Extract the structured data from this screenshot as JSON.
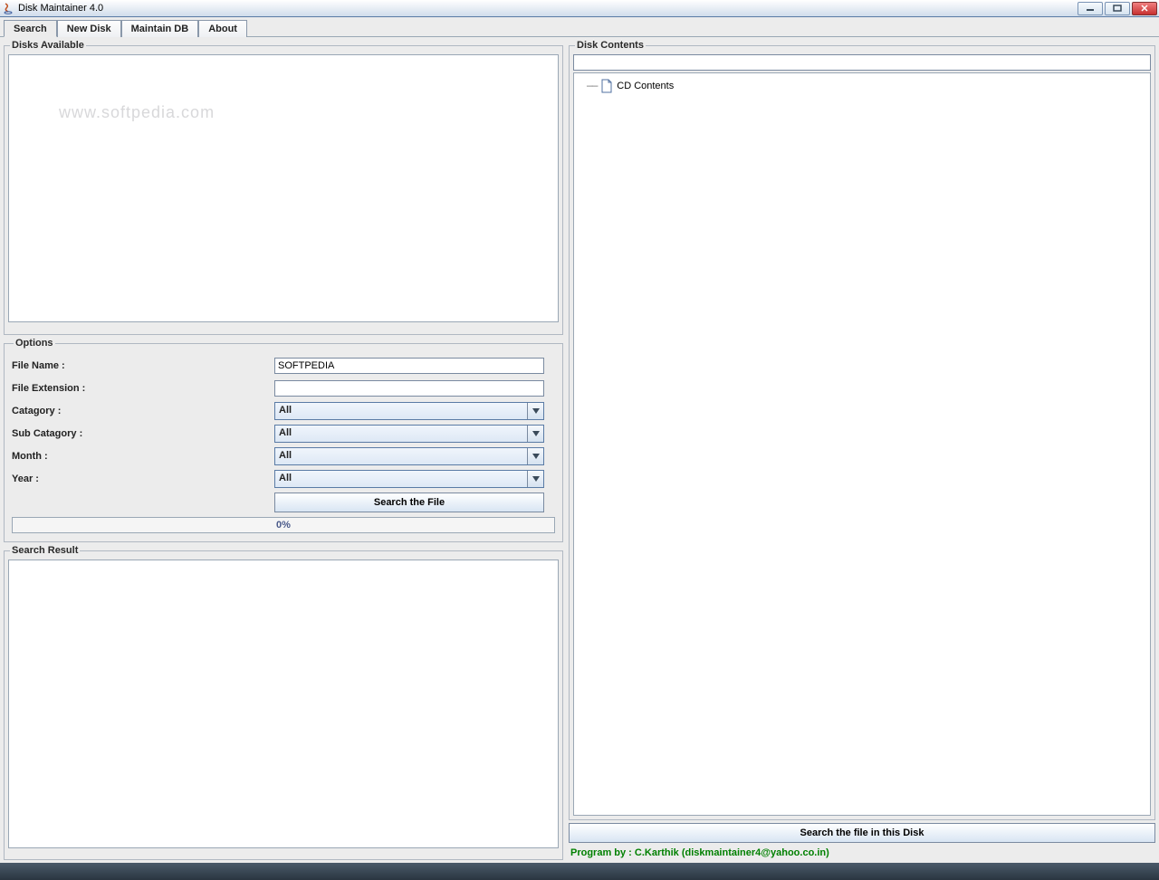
{
  "window": {
    "title": "Disk Maintainer 4.0"
  },
  "tabs": [
    "Search",
    "New Disk",
    "Maintain DB",
    "About"
  ],
  "left": {
    "disks_available_legend": "Disks Available",
    "watermark": "www.softpedia.com",
    "options_legend": "Options",
    "labels": {
      "file_name": "File Name :",
      "file_extension": "File Extension :",
      "category": "Catagory :",
      "sub_category": "Sub Catagory :",
      "month": "Month :",
      "year": "Year :"
    },
    "values": {
      "file_name": "SOFTPEDIA",
      "file_extension": "",
      "category": "All",
      "sub_category": "All",
      "month": "All",
      "year": "All"
    },
    "search_button": "Search the File",
    "progress": "0%",
    "search_result_legend": "Search Result"
  },
  "right": {
    "disk_contents_legend": "Disk Contents",
    "tree_root": "CD Contents",
    "search_disk_button": "Search the file in this Disk",
    "credit": "Program by : C.Karthik (diskmaintainer4@yahoo.co.in)"
  }
}
